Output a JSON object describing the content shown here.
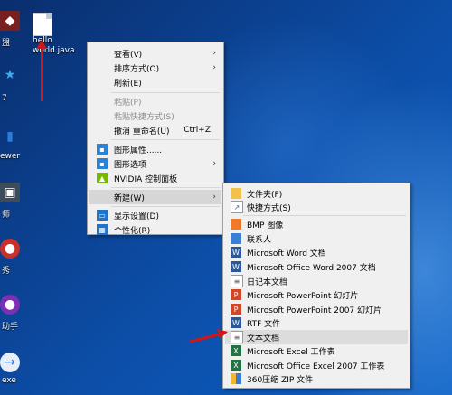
{
  "desktop": {
    "file": {
      "name_line1": "hello",
      "name_line2": "world.java"
    },
    "left_labels": [
      "盟",
      "7",
      "ewer",
      "师",
      "秀",
      "助手",
      "exe"
    ]
  },
  "context_menu": {
    "items": [
      {
        "label": "查看(V)",
        "submenu": true
      },
      {
        "label": "排序方式(O)",
        "submenu": true
      },
      {
        "label": "刷新(E)"
      },
      {
        "label": "粘贴(P)",
        "disabled": true
      },
      {
        "label": "粘贴快捷方式(S)",
        "disabled": true
      },
      {
        "label": "撤消 重命名(U)",
        "shortcut": "Ctrl+Z"
      },
      {
        "label": "图形属性......",
        "icon": "graphics-icon"
      },
      {
        "label": "图形选项",
        "icon": "graphics-icon",
        "submenu": true
      },
      {
        "label": "NVIDIA 控制面板",
        "icon": "nvidia-icon"
      },
      {
        "label": "新建(W)",
        "submenu": true,
        "active": true
      },
      {
        "label": "显示设置(D)",
        "icon": "display-icon"
      },
      {
        "label": "个性化(R)",
        "icon": "personalize-icon"
      }
    ]
  },
  "new_submenu": {
    "items": [
      {
        "label": "文件夹(F)",
        "icon": "folder-icon"
      },
      {
        "label": "快捷方式(S)",
        "icon": "shortcut-icon"
      },
      {
        "label": "BMP 图像",
        "icon": "bmp-icon"
      },
      {
        "label": "联系人",
        "icon": "contact-icon"
      },
      {
        "label": "Microsoft Word 文档",
        "icon": "word-icon"
      },
      {
        "label": "Microsoft Office Word 2007 文档",
        "icon": "word-icon"
      },
      {
        "label": "日记本文档",
        "icon": "journal-icon"
      },
      {
        "label": "Microsoft PowerPoint 幻灯片",
        "icon": "powerpoint-icon"
      },
      {
        "label": "Microsoft PowerPoint 2007 幻灯片",
        "icon": "powerpoint-icon"
      },
      {
        "label": "RTF 文件",
        "icon": "rtf-icon"
      },
      {
        "label": "文本文档",
        "icon": "text-doc-icon",
        "highlight": true
      },
      {
        "label": "Microsoft Excel 工作表",
        "icon": "excel-icon"
      },
      {
        "label": "Microsoft Office Excel 2007 工作表",
        "icon": "excel-icon"
      },
      {
        "label": "360压缩 ZIP 文件",
        "icon": "zip-icon"
      }
    ]
  }
}
